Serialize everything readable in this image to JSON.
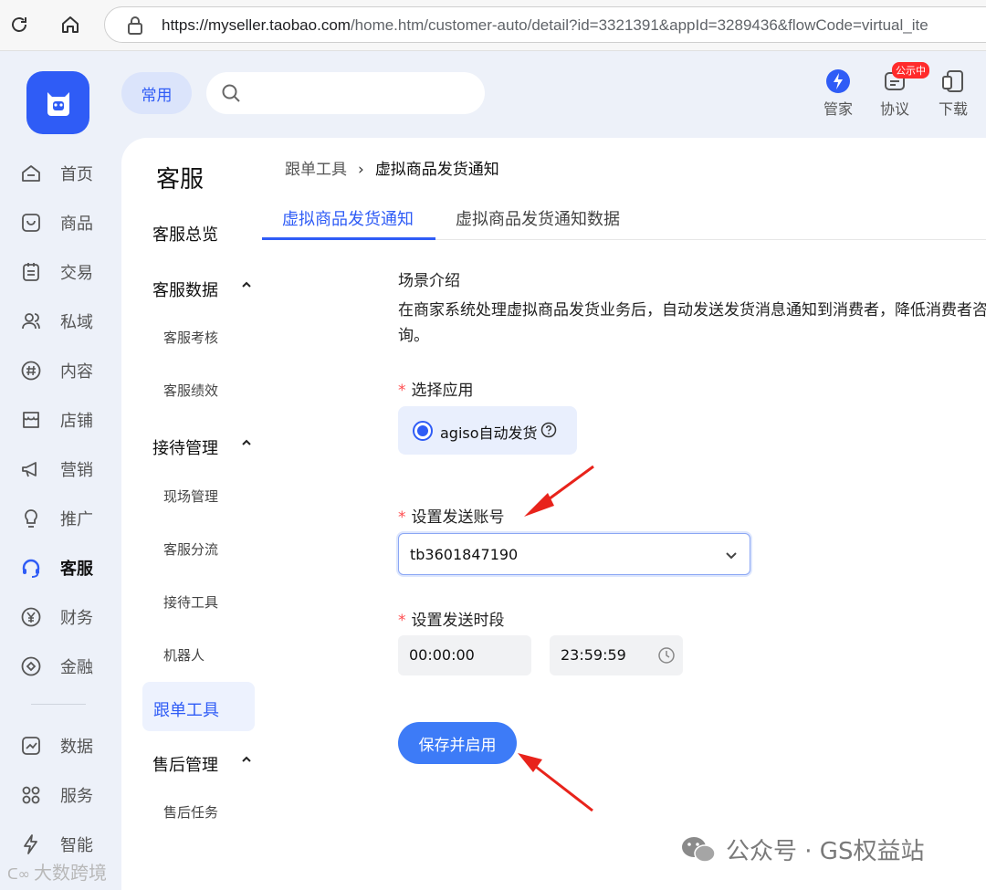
{
  "browser": {
    "url_host": "https://myseller.taobao.com",
    "url_path": "/home.htm/customer-auto/detail?id=3321391&appId=3289436&flowCode=virtual_ite"
  },
  "header": {
    "common_chip": "常用",
    "tools": [
      {
        "label": "管家",
        "icon": "lightning-icon"
      },
      {
        "label": "协议",
        "icon": "agreement-icon",
        "badge": "公示中"
      },
      {
        "label": "下载",
        "icon": "devices-icon"
      }
    ]
  },
  "left_nav": {
    "items": [
      {
        "label": "首页",
        "icon": "home-icon"
      },
      {
        "label": "商品",
        "icon": "goods-icon"
      },
      {
        "label": "交易",
        "icon": "trade-icon"
      },
      {
        "label": "私域",
        "icon": "users-icon"
      },
      {
        "label": "内容",
        "icon": "hash-icon"
      },
      {
        "label": "店铺",
        "icon": "store-icon"
      },
      {
        "label": "营销",
        "icon": "megaphone-icon"
      },
      {
        "label": "推广",
        "icon": "bulb-icon"
      },
      {
        "label": "客服",
        "icon": "headset-icon"
      },
      {
        "label": "财务",
        "icon": "yen-icon"
      },
      {
        "label": "金融",
        "icon": "finance-icon"
      },
      {
        "label": "数据",
        "icon": "chart-icon"
      },
      {
        "label": "服务",
        "icon": "apps-icon"
      },
      {
        "label": "智能",
        "icon": "bolt-icon"
      }
    ],
    "active": "客服"
  },
  "sub_menu": {
    "title": "客服",
    "overview": "客服总览",
    "group_data": "客服数据",
    "data_items": [
      "客服考核",
      "客服绩效"
    ],
    "group_reception": "接待管理",
    "reception_items": [
      "现场管理",
      "客服分流",
      "接待工具",
      "机器人"
    ],
    "active_item": "跟单工具",
    "group_aftersale": "售后管理",
    "aftersale_items": [
      "售后任务"
    ]
  },
  "content": {
    "breadcrumb_parent": "跟单工具",
    "breadcrumb_sep": "›",
    "breadcrumb_current": "虚拟商品发货通知",
    "tabs": [
      "虚拟商品发货通知",
      "虚拟商品发货通知数据"
    ],
    "scene_title": "场景介绍",
    "scene_desc": "在商家系统处理虚拟商品发货业务后，自动发送发货消息通知到消费者，降低消费者咨询。",
    "required_mark": "*",
    "app_label": "选择应用",
    "app_option": "agiso自动发货",
    "account_label": "设置发送账号",
    "account_value": "tb3601847190",
    "time_label": "设置发送时段",
    "time_start": "00:00:00",
    "time_end": "23:59:59",
    "save_button": "保存并启用"
  },
  "watermarks": {
    "right": "公众号 · GS权益站",
    "left": "大数跨境"
  },
  "colors": {
    "brand_blue": "#2f5cf6",
    "button_blue": "#3d7bf7",
    "arrow_red": "#e8231b",
    "required_red": "#ff4d4f"
  }
}
